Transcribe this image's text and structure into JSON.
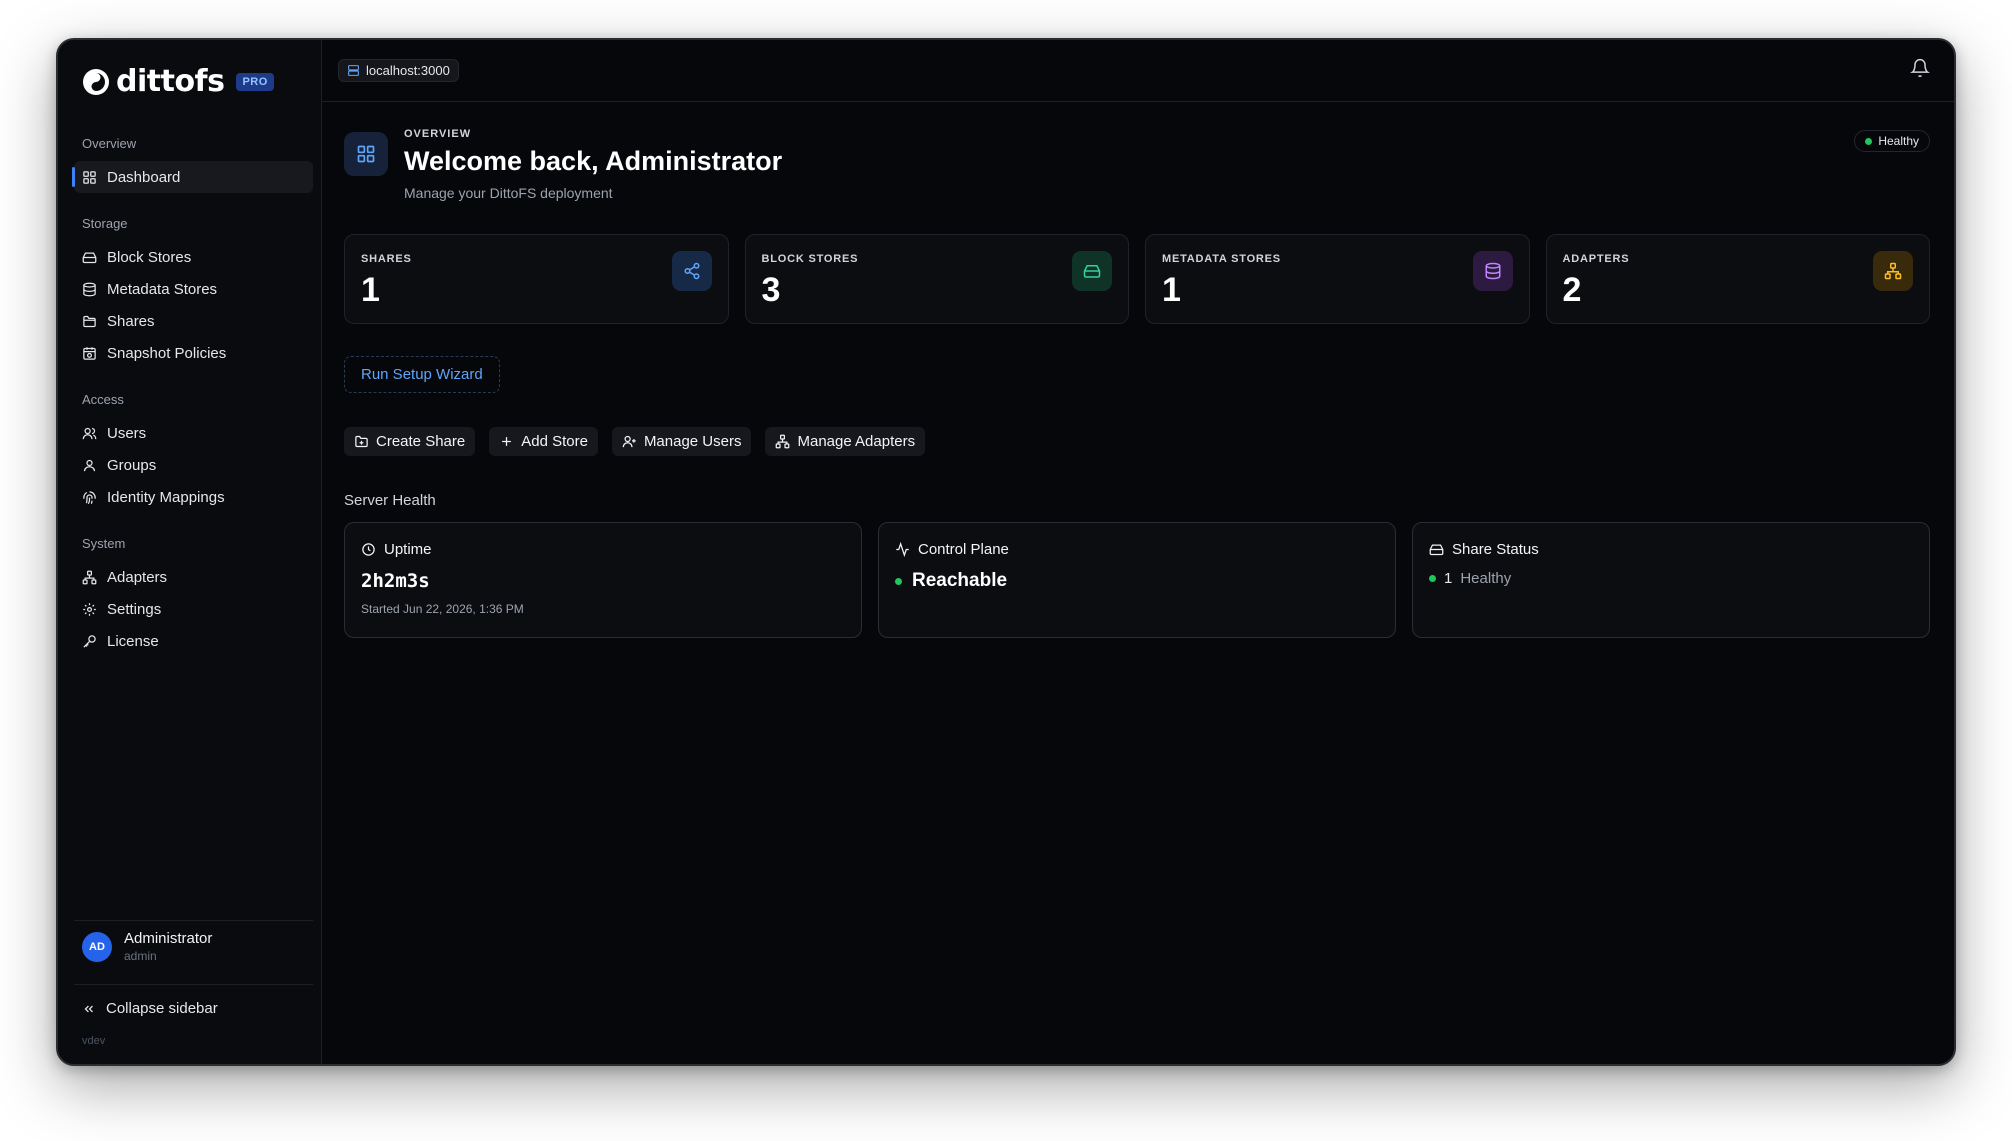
{
  "app": {
    "name": "dittofs",
    "badge": "PRO",
    "version": "vdev"
  },
  "topbar": {
    "host": "localhost:3000"
  },
  "sidebar": {
    "sections": [
      {
        "title": "Overview",
        "items": [
          {
            "label": "Dashboard",
            "icon": "grid-icon",
            "active": true
          }
        ]
      },
      {
        "title": "Storage",
        "items": [
          {
            "label": "Block Stores",
            "icon": "hard-drive-icon"
          },
          {
            "label": "Metadata Stores",
            "icon": "database-icon"
          },
          {
            "label": "Shares",
            "icon": "folder-icon"
          },
          {
            "label": "Snapshot Policies",
            "icon": "calendar-clock-icon"
          }
        ]
      },
      {
        "title": "Access",
        "items": [
          {
            "label": "Users",
            "icon": "user-icon"
          },
          {
            "label": "Groups",
            "icon": "users-icon"
          },
          {
            "label": "Identity Mappings",
            "icon": "fingerprint-icon"
          }
        ]
      },
      {
        "title": "System",
        "items": [
          {
            "label": "Adapters",
            "icon": "network-icon"
          },
          {
            "label": "Settings",
            "icon": "gear-icon"
          },
          {
            "label": "License",
            "icon": "key-icon"
          }
        ]
      }
    ],
    "user": {
      "initials": "AD",
      "name": "Administrator",
      "role": "admin"
    },
    "collapse_label": "Collapse sidebar"
  },
  "header": {
    "eyebrow": "OVERVIEW",
    "title": "Welcome back, Administrator",
    "subtitle": "Manage your DittoFS deployment",
    "status": "Healthy"
  },
  "stats": [
    {
      "label": "SHARES",
      "value": "1",
      "icon": "share-icon",
      "color": "#60a5fa"
    },
    {
      "label": "BLOCK STORES",
      "value": "3",
      "icon": "hard-drive-icon",
      "color": "#34d399"
    },
    {
      "label": "METADATA STORES",
      "value": "1",
      "icon": "database-icon",
      "color": "#c084fc"
    },
    {
      "label": "ADAPTERS",
      "value": "2",
      "icon": "network-icon",
      "color": "#fbbf24"
    }
  ],
  "wizard_label": "Run Setup Wizard",
  "actions": [
    {
      "label": "Create Share",
      "icon": "folder-plus-icon"
    },
    {
      "label": "Add Store",
      "icon": "plus-icon"
    },
    {
      "label": "Manage Users",
      "icon": "user-plus-icon"
    },
    {
      "label": "Manage Adapters",
      "icon": "network-icon"
    }
  ],
  "server_health": {
    "title": "Server Health",
    "uptime": {
      "label": "Uptime",
      "value": "2h2m3s",
      "started": "Started Jun 22, 2026, 1:36 PM"
    },
    "control_plane": {
      "label": "Control Plane",
      "value": "Reachable"
    },
    "share_status": {
      "label": "Share Status",
      "count": "1",
      "state": "Healthy"
    }
  },
  "colors": {
    "accent": "#3b82f6",
    "healthy": "#22c55e",
    "background": "#06070a"
  }
}
